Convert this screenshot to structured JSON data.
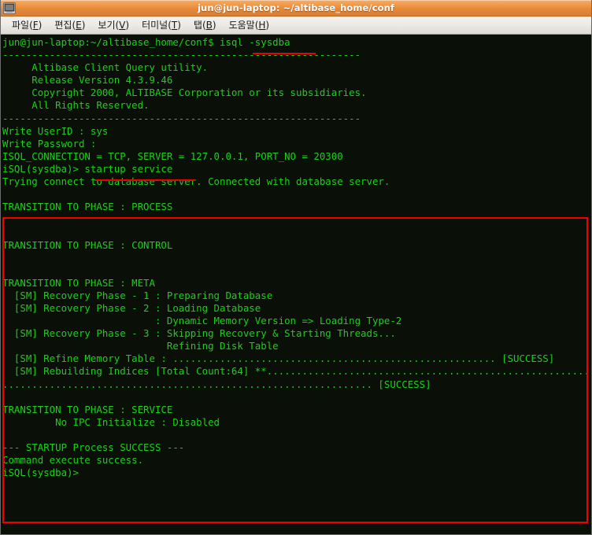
{
  "window": {
    "title": "jun@jun-laptop: ~/altibase_home/conf",
    "icon": "terminal-icon"
  },
  "menubar": {
    "items": [
      {
        "label": "파일",
        "pre": "파일(",
        "mnemonic": "F",
        "post": ")"
      },
      {
        "label": "편집",
        "pre": "편집(",
        "mnemonic": "E",
        "post": ")"
      },
      {
        "label": "보기",
        "pre": "보기(",
        "mnemonic": "V",
        "post": ")"
      },
      {
        "label": "터미널",
        "pre": "터미널(",
        "mnemonic": "T",
        "post": ")"
      },
      {
        "label": "탭",
        "pre": "탭(",
        "mnemonic": "B",
        "post": ")"
      },
      {
        "label": "도움말",
        "pre": "도움말(",
        "mnemonic": "H",
        "post": ")"
      }
    ]
  },
  "terminal": {
    "colors": {
      "background": "#0a0f08",
      "foreground": "#19d119",
      "annotation": "#f20000"
    },
    "lines": [
      "jun@jun-laptop:~/altibase_home/conf$ isql -sysdba",
      "-------------------------------------------------------------",
      "     Altibase Client Query utility.",
      "     Release Version 4.3.9.46",
      "     Copyright 2000, ALTIBASE Corporation or its subsidiaries.",
      "     All Rights Reserved.",
      "-------------------------------------------------------------",
      "Write UserID : sys",
      "Write Password : ",
      "ISQL_CONNECTION = TCP, SERVER = 127.0.0.1, PORT_NO = 20300",
      "iSQL(sysdba)> startup service",
      "Trying connect to database server. Connected with database server.",
      "",
      "TRANSITION TO PHASE : PROCESS",
      "",
      "",
      "TRANSITION TO PHASE : CONTROL",
      "",
      "",
      "TRANSITION TO PHASE : META",
      "  [SM] Recovery Phase - 1 : Preparing Database",
      "  [SM] Recovery Phase - 2 : Loading Database",
      "                          : Dynamic Memory Version => Loading Type-2",
      "  [SM] Recovery Phase - 3 : Skipping Recovery & Starting Threads...",
      "                            Refining Disk Table",
      "  [SM] Refine Memory Table : ....................................................... [SUCCESS]",
      "  [SM] Rebuilding Indices [Total Count:64] **............................................................",
      "............................................................... [SUCCESS]",
      "",
      "TRANSITION TO PHASE : SERVICE",
      "         No IPC Initialize : Disabled",
      "",
      "--- STARTUP Process SUCCESS ---",
      "Command execute success.",
      "iSQL(sysdba)>"
    ],
    "annotations": {
      "underline_command_1": "isql -sysdba",
      "underline_command_2": "startup service",
      "highlight_box_label": "startup-output-region"
    }
  }
}
